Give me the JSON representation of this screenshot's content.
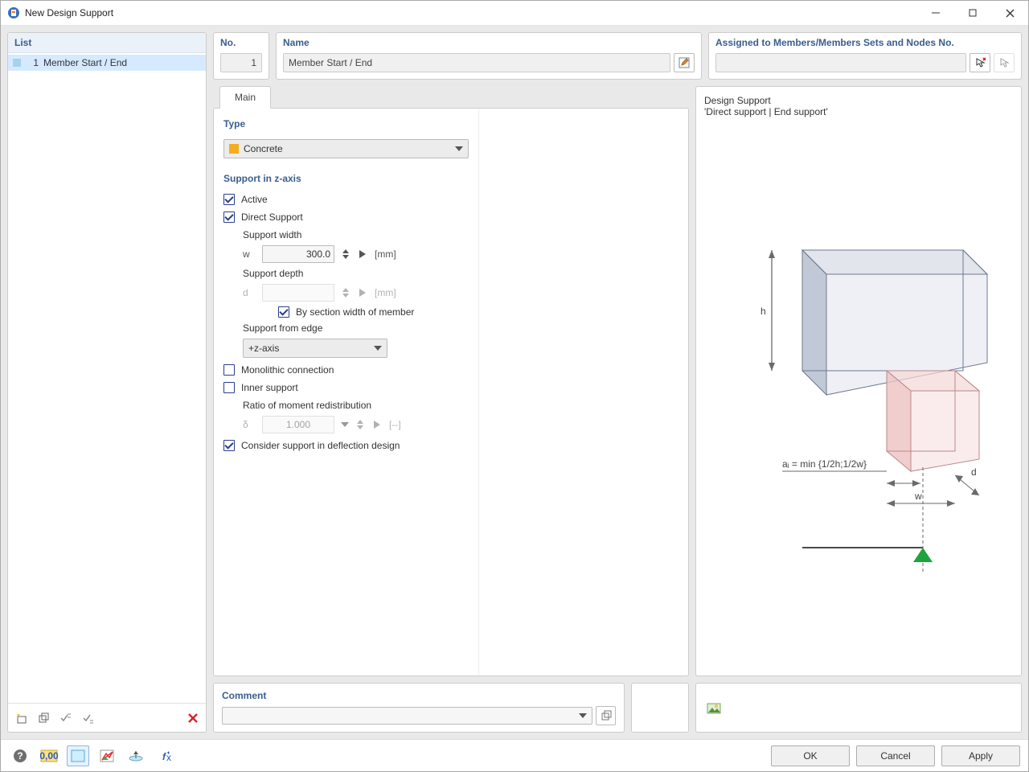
{
  "window": {
    "title": "New Design Support"
  },
  "list": {
    "header": "List",
    "items": [
      {
        "no": "1",
        "label": "Member Start / End"
      }
    ]
  },
  "head": {
    "no_label": "No.",
    "no_value": "1",
    "name_label": "Name",
    "name_value": "Member Start / End",
    "assign_label": "Assigned to Members/Members Sets and Nodes No.",
    "assign_value": ""
  },
  "tabs": {
    "main": "Main"
  },
  "form": {
    "type_title": "Type",
    "type_value": "Concrete",
    "support_z_title": "Support in z-axis",
    "active": {
      "label": "Active",
      "checked": true
    },
    "direct_support": {
      "label": "Direct Support",
      "checked": true
    },
    "support_width_label": "Support width",
    "w_sym": "w",
    "w_value": "300.0",
    "w_unit": "[mm]",
    "support_depth_label": "Support depth",
    "d_sym": "d",
    "d_value": "",
    "d_unit": "[mm]",
    "by_section": {
      "label": "By section width of member",
      "checked": true
    },
    "support_from_edge_label": "Support from edge",
    "support_from_edge_value": "+z-axis",
    "monolithic": {
      "label": "Monolithic connection",
      "checked": false
    },
    "inner_support": {
      "label": "Inner support",
      "checked": false
    },
    "ratio_label": "Ratio of moment redistribution",
    "delta_sym": "δ",
    "delta_value": "1.000",
    "delta_unit": "[--]",
    "consider_deflection": {
      "label": "Consider support in deflection design",
      "checked": true
    }
  },
  "preview": {
    "title": "Design Support",
    "sub": "'Direct support | End support'",
    "label_h": "h",
    "label_d": "d",
    "label_w": "w",
    "label_ai": "aᵢ = min {1/2h;1/2w}"
  },
  "comment": {
    "header": "Comment",
    "value": ""
  },
  "footer": {
    "ok": "OK",
    "cancel": "Cancel",
    "apply": "Apply"
  }
}
